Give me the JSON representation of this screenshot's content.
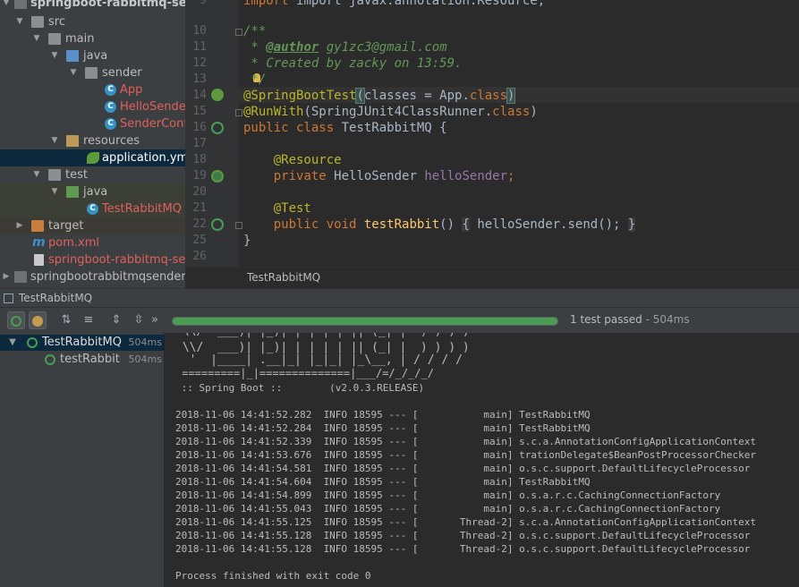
{
  "tree": {
    "items": [
      {
        "label": "springboot-rabbitmq-sender"
      },
      {
        "label": "src"
      },
      {
        "label": "main"
      },
      {
        "label": "java"
      },
      {
        "label": "sender"
      },
      {
        "label": "App"
      },
      {
        "label": "HelloSender"
      },
      {
        "label": "SenderConf"
      },
      {
        "label": "resources"
      },
      {
        "label": "application.yml"
      },
      {
        "label": "test"
      },
      {
        "label": "java"
      },
      {
        "label": "TestRabbitMQ"
      },
      {
        "label": "target"
      },
      {
        "label": "pom.xml"
      },
      {
        "label": "springboot-rabbitmq-sender.iml"
      },
      {
        "label": "springbootrabbitmqsender"
      }
    ]
  },
  "editor": {
    "line_numbers": [
      "9",
      "10",
      "11",
      "12",
      "13",
      "14",
      "15",
      "16",
      "17",
      "18",
      "19",
      "20",
      "21",
      "22",
      "25",
      "26"
    ],
    "line0": "import javax.annotation.Resource;",
    "doc_open": "/**",
    "doc_star": " * ",
    "author_tag": "@author",
    "author_value": " gy1zc3@gmail.com",
    "created": " * Created by zacky on 13:59.",
    "doc_close": " */",
    "ann_springboot": "@SpringBootTest",
    "classes_arg": "classes = App.",
    "class_kw": "class",
    "ann_runwith": "@RunWith",
    "runwith_arg": "(SpringJUnit4ClassRunner.",
    "public_class": "public class ",
    "class_name": "TestRabbitMQ {",
    "ann_resource": "@Resource",
    "private_kw": "private ",
    "field_type": "HelloSender ",
    "field_name": "helloSender",
    "ann_test": "@Test",
    "public_void": "public void ",
    "method_name": "testRabbit",
    "method_body_pre": "() ",
    "method_body": " helloSender.send(); ",
    "closing": "}",
    "breadcrumb": "TestRabbitMQ"
  },
  "run": {
    "tab_title": "TestRabbitMQ",
    "status_text": "1 test passed",
    "status_time": " - 504ms",
    "tests": [
      {
        "name": "TestRabbitMQ",
        "time": "504ms"
      },
      {
        "name": "testRabbit",
        "time": "504ms"
      }
    ],
    "banner": [
      " \\\\/  ___)| |_)| | | | | || (_| |  ) ) ) )",
      "  '  |____| .__|_| |_|_| |_\\__, | / / / /",
      " =========|_|==============|___/=/_/_/_/",
      " :: Spring Boot ::        (v2.0.3.RELEASE)"
    ],
    "log_lines": [
      "2018-11-06 14:41:52.282  INFO 18595 --- [           main] TestRabbitMQ",
      "2018-11-06 14:41:52.284  INFO 18595 --- [           main] TestRabbitMQ",
      "2018-11-06 14:41:52.339  INFO 18595 --- [           main] s.c.a.AnnotationConfigApplicationContext",
      "2018-11-06 14:41:53.676  INFO 18595 --- [           main] trationDelegate$BeanPostProcessorChecker",
      "2018-11-06 14:41:54.581  INFO 18595 --- [           main] o.s.c.support.DefaultLifecycleProcessor",
      "2018-11-06 14:41:54.604  INFO 18595 --- [           main] TestRabbitMQ",
      "2018-11-06 14:41:54.899  INFO 18595 --- [           main] o.s.a.r.c.CachingConnectionFactory",
      "2018-11-06 14:41:55.043  INFO 18595 --- [           main] o.s.a.r.c.CachingConnectionFactory",
      "2018-11-06 14:41:55.125  INFO 18595 --- [       Thread-2] s.c.a.AnnotationConfigApplicationContext",
      "2018-11-06 14:41:55.128  INFO 18595 --- [       Thread-2] o.s.c.support.DefaultLifecycleProcessor",
      "2018-11-06 14:41:55.128  INFO 18595 --- [       Thread-2] o.s.c.support.DefaultLifecycleProcessor"
    ],
    "exit_text": "Process finished with exit code 0"
  }
}
